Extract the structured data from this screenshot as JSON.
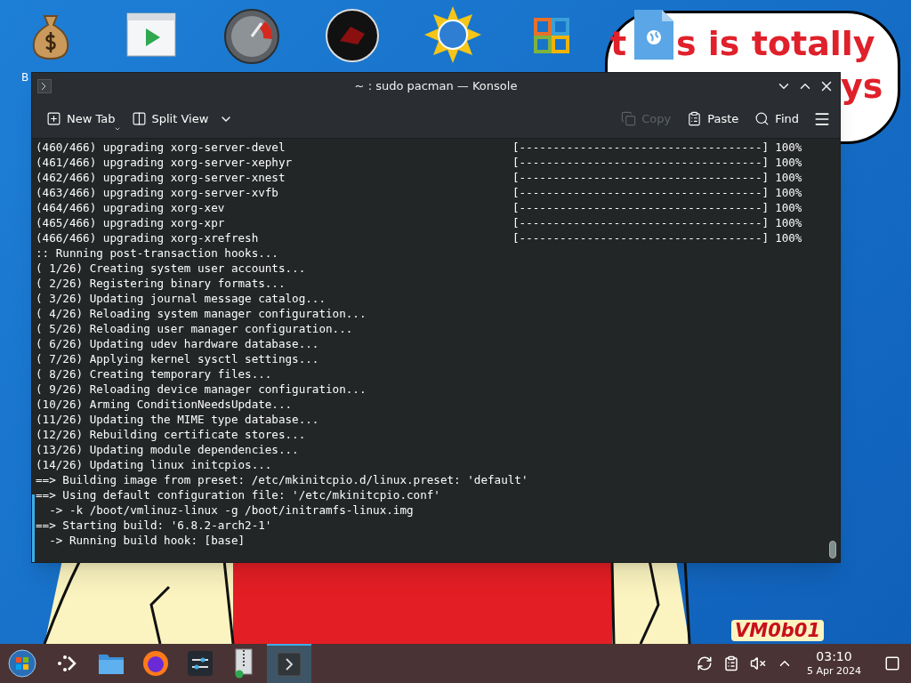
{
  "desktop": {
    "icon_labels": [
      "B"
    ],
    "bubble_texts": [
      "t",
      "s is totally",
      "ys"
    ],
    "corner_text": "VM0b01"
  },
  "window": {
    "title": "~ : sudo pacman — Konsole",
    "toolbar": [
      {
        "kind": "new-tab",
        "label": "New Tab",
        "disabled": false
      },
      {
        "kind": "split-view",
        "label": "Split View",
        "disabled": false
      },
      {
        "kind": "copy",
        "label": "Copy",
        "disabled": true
      },
      {
        "kind": "paste",
        "label": "Paste",
        "disabled": false
      },
      {
        "kind": "find",
        "label": "Find",
        "disabled": false
      }
    ]
  },
  "terminal": {
    "lines": [
      {
        "text": "(460/466) upgrading xorg-server-devel",
        "bar": "[------------------------------------]",
        "percent": "100%"
      },
      {
        "text": "(461/466) upgrading xorg-server-xephyr",
        "bar": "[------------------------------------]",
        "percent": "100%"
      },
      {
        "text": "(462/466) upgrading xorg-server-xnest",
        "bar": "[------------------------------------]",
        "percent": "100%"
      },
      {
        "text": "(463/466) upgrading xorg-server-xvfb",
        "bar": "[------------------------------------]",
        "percent": "100%"
      },
      {
        "text": "(464/466) upgrading xorg-xev",
        "bar": "[------------------------------------]",
        "percent": "100%"
      },
      {
        "text": "(465/466) upgrading xorg-xpr",
        "bar": "[------------------------------------]",
        "percent": "100%"
      },
      {
        "text": "(466/466) upgrading xorg-xrefresh",
        "bar": "[------------------------------------]",
        "percent": "100%"
      },
      {
        "text": ":: Running post-transaction hooks..."
      },
      {
        "text": "( 1/26) Creating system user accounts..."
      },
      {
        "text": "( 2/26) Registering binary formats..."
      },
      {
        "text": "( 3/26) Updating journal message catalog..."
      },
      {
        "text": "( 4/26) Reloading system manager configuration..."
      },
      {
        "text": "( 5/26) Reloading user manager configuration..."
      },
      {
        "text": "( 6/26) Updating udev hardware database..."
      },
      {
        "text": "( 7/26) Applying kernel sysctl settings..."
      },
      {
        "text": "( 8/26) Creating temporary files..."
      },
      {
        "text": "( 9/26) Reloading device manager configuration..."
      },
      {
        "text": "(10/26) Arming ConditionNeedsUpdate..."
      },
      {
        "text": "(11/26) Updating the MIME type database..."
      },
      {
        "text": "(12/26) Rebuilding certificate stores..."
      },
      {
        "text": "(13/26) Updating module dependencies..."
      },
      {
        "text": "(14/26) Updating linux initcpios..."
      },
      {
        "text": "==> Building image from preset: /etc/mkinitcpio.d/linux.preset: 'default'"
      },
      {
        "text": "==> Using default configuration file: '/etc/mkinitcpio.conf'"
      },
      {
        "text": "  -> -k /boot/vmlinuz-linux -g /boot/initramfs-linux.img"
      },
      {
        "text": "==> Starting build: '6.8.2-arch2-1'"
      },
      {
        "text": "  -> Running build hook: [base]"
      }
    ]
  },
  "taskbar": {
    "items": [
      {
        "kind": "start",
        "selected": false
      },
      {
        "kind": "launcher",
        "selected": false
      },
      {
        "kind": "files",
        "selected": false
      },
      {
        "kind": "browser",
        "selected": false
      },
      {
        "kind": "settings",
        "selected": false
      },
      {
        "kind": "archive",
        "selected": false
      },
      {
        "kind": "terminal",
        "selected": true
      }
    ],
    "clock": {
      "time": "03:10",
      "date": "5 Apr 2024"
    }
  }
}
